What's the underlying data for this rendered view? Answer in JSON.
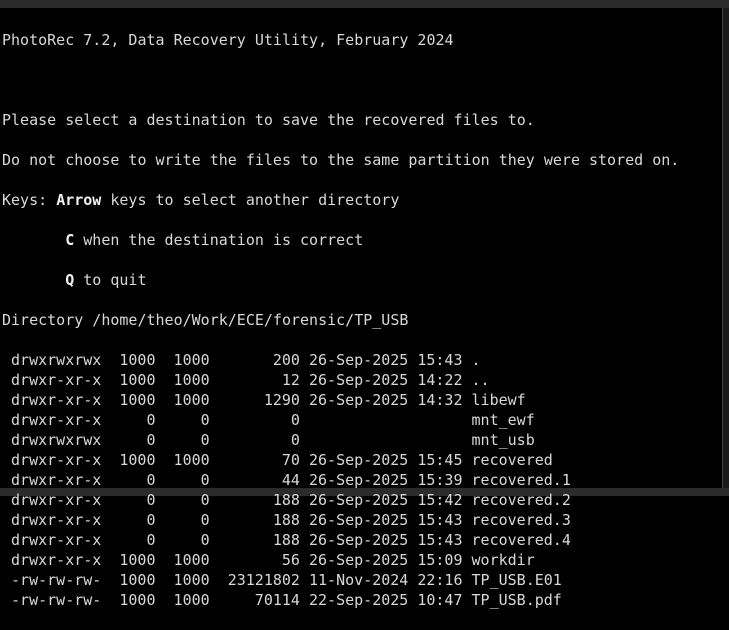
{
  "title": "PhotoRec 7.2, Data Recovery Utility, February 2024",
  "intro": [
    "Please select a destination to save the recovered files to.",
    "Do not choose to write the files to the same partition they were stored on."
  ],
  "keys": {
    "prefix": "Keys: ",
    "arrow_key": "Arrow",
    "arrow_text": " keys to select another directory",
    "c_key": "C",
    "c_text": " when the destination is correct",
    "q_key": "Q",
    "q_text": " to quit"
  },
  "directory": "Directory /home/theo/Work/ECE/forensic/TP_USB",
  "selected_marker": ">",
  "selected_index": 13,
  "rows": [
    {
      "perms": "drwxrwxrwx",
      "uid": "1000",
      "gid": "1000",
      "size": "200",
      "date": "26-Sep-2025",
      "time": "15:43",
      "name": "."
    },
    {
      "perms": "drwxr-xr-x",
      "uid": "1000",
      "gid": "1000",
      "size": "12",
      "date": "26-Sep-2025",
      "time": "14:22",
      "name": ".."
    },
    {
      "perms": "drwxr-xr-x",
      "uid": "1000",
      "gid": "1000",
      "size": "1290",
      "date": "26-Sep-2025",
      "time": "14:32",
      "name": "libewf"
    },
    {
      "perms": "drwxr-xr-x",
      "uid": "0",
      "gid": "0",
      "size": "0",
      "date": "",
      "time": "",
      "name": "mnt_ewf"
    },
    {
      "perms": "drwxrwxrwx",
      "uid": "0",
      "gid": "0",
      "size": "0",
      "date": "",
      "time": "",
      "name": "mnt_usb"
    },
    {
      "perms": "drwxr-xr-x",
      "uid": "1000",
      "gid": "1000",
      "size": "70",
      "date": "26-Sep-2025",
      "time": "15:45",
      "name": "recovered"
    },
    {
      "perms": "drwxr-xr-x",
      "uid": "0",
      "gid": "0",
      "size": "44",
      "date": "26-Sep-2025",
      "time": "15:39",
      "name": "recovered.1"
    },
    {
      "perms": "drwxr-xr-x",
      "uid": "0",
      "gid": "0",
      "size": "188",
      "date": "26-Sep-2025",
      "time": "15:42",
      "name": "recovered.2"
    },
    {
      "perms": "drwxr-xr-x",
      "uid": "0",
      "gid": "0",
      "size": "188",
      "date": "26-Sep-2025",
      "time": "15:43",
      "name": "recovered.3"
    },
    {
      "perms": "drwxr-xr-x",
      "uid": "0",
      "gid": "0",
      "size": "188",
      "date": "26-Sep-2025",
      "time": "15:43",
      "name": "recovered.4"
    },
    {
      "perms": "drwxr-xr-x",
      "uid": "1000",
      "gid": "1000",
      "size": "56",
      "date": "26-Sep-2025",
      "time": "15:09",
      "name": "workdir"
    },
    {
      "perms": "-rw-rw-rw-",
      "uid": "1000",
      "gid": "1000",
      "size": "23121802",
      "date": "11-Nov-2024",
      "time": "22:16",
      "name": "TP_USB.E01"
    },
    {
      "perms": "-rw-rw-rw-",
      "uid": "1000",
      "gid": "1000",
      "size": "70114",
      "date": "22-Sep-2025",
      "time": "10:47",
      "name": "TP_USB.pdf"
    }
  ]
}
